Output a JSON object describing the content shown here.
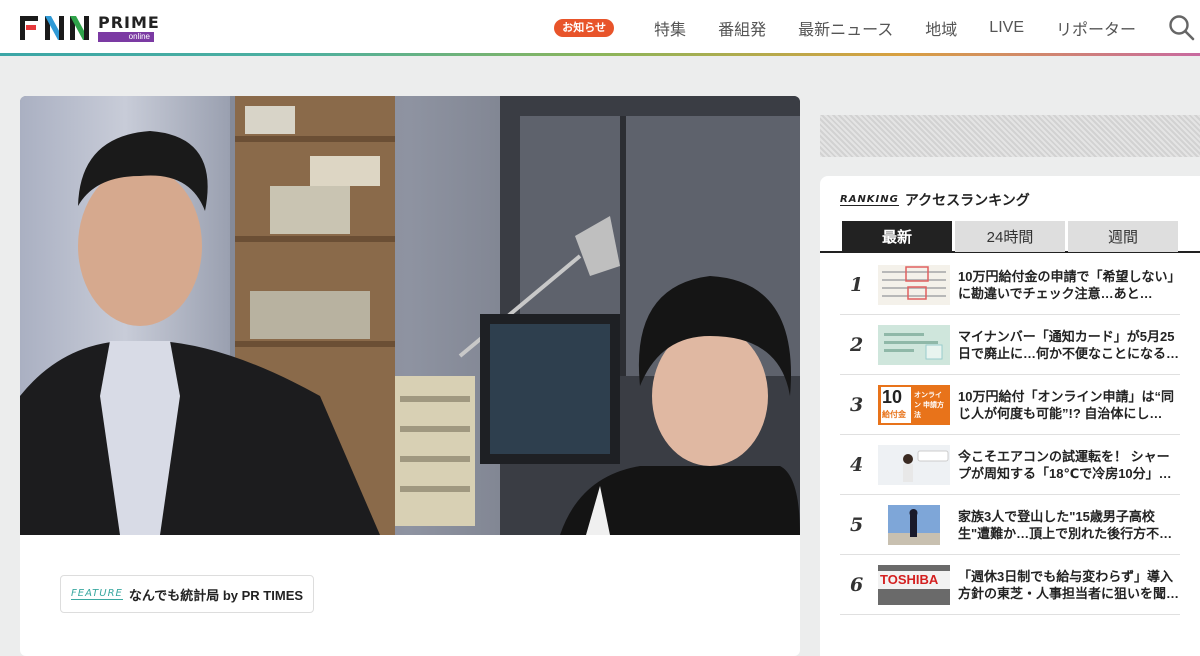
{
  "header": {
    "logo": {
      "brand": "FNN",
      "product": "PRIME",
      "sub": "online"
    },
    "notice_badge": "お知らせ",
    "nav": [
      "特集",
      "番組発",
      "最新ニュース",
      "地域",
      "LIVE",
      "リポーター"
    ],
    "search_icon": "search-icon"
  },
  "article": {
    "feature_tag": {
      "en": "FEATURE",
      "label": "なんでも統計局 by PR TIMES"
    }
  },
  "ranking": {
    "heading_en": "RANKING",
    "heading": "アクセスランキング",
    "tabs": [
      "最新",
      "24時間",
      "週間"
    ],
    "active_tab": "最新",
    "items": [
      {
        "rank": "1",
        "title": "10万円給付金の申請で「希望しない」に勘違いでチェック注意…あと…"
      },
      {
        "rank": "2",
        "title": "マイナンバー「通知カード」が5月25日で廃止に…何か不便なことになる…"
      },
      {
        "rank": "3",
        "title": "10万円給付「オンライン申請」は“同じ人が何度も可能”!? 自治体にし…"
      },
      {
        "rank": "4",
        "title": "今こそエアコンの試運転を！ シャープが周知する「18℃で冷房10分」…"
      },
      {
        "rank": "5",
        "title": "家族3人で登山した\"15歳男子高校生\"遭難か…頂上で別れた後行方不…"
      },
      {
        "rank": "6",
        "title": "「週休3日制でも給与変わらず」導入方針の東芝・人事担当者に狙いを聞…"
      }
    ],
    "thumb_texts": {
      "t3_big": "10",
      "t3_small": "オンライン 申請方法",
      "t3_label": "給付金",
      "t6": "TOSHIBA"
    }
  },
  "colors": {
    "accent_orange": "#e8542a",
    "brand_purple": "#7b3aa3",
    "brand_teal": "#3aa8a0"
  }
}
